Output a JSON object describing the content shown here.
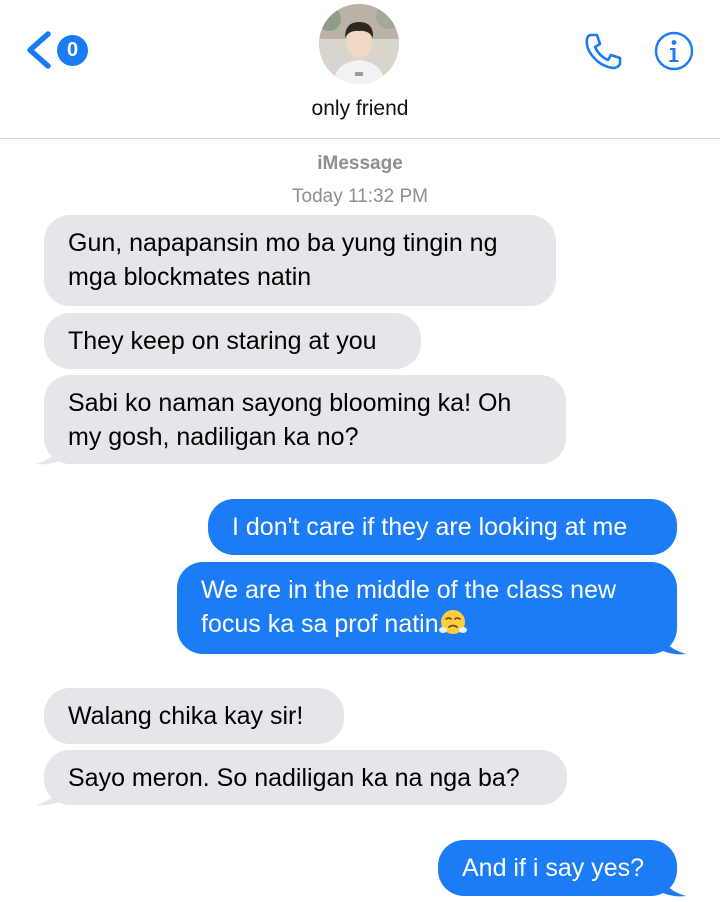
{
  "header": {
    "unread_count": "0",
    "contact_name": "only friend"
  },
  "thread": {
    "service_label": "iMessage",
    "timestamp": "Today 11:32 PM"
  },
  "messages": [
    {
      "from": "friend",
      "lines": [
        "Gun, napapansin mo ba yung tingin ng",
        "mga blockmates natin"
      ]
    },
    {
      "from": "friend",
      "lines": [
        "They keep on staring at you"
      ]
    },
    {
      "from": "friend",
      "lines": [
        "Sabi ko naman sayong blooming ka! Oh",
        "my gosh, nadiligan ka no?"
      ]
    },
    {
      "from": "me",
      "lines": [
        "I don't care if they are looking at me"
      ]
    },
    {
      "from": "me",
      "lines": [
        "We are in the middle of the class new",
        "focus ka sa prof natin"
      ],
      "emoji": "face-with-steam-from-nose"
    },
    {
      "from": "friend",
      "lines": [
        "Walang chika kay sir!"
      ]
    },
    {
      "from": "friend",
      "lines": [
        "Sayo meron. So nadiligan ka na nga ba?"
      ]
    },
    {
      "from": "me",
      "lines": [
        "And if i say yes?"
      ]
    }
  ],
  "colors": {
    "accent": "#1b7cf5",
    "received_bubble": "#e5e5ea",
    "meta_text": "#8e8e93"
  }
}
